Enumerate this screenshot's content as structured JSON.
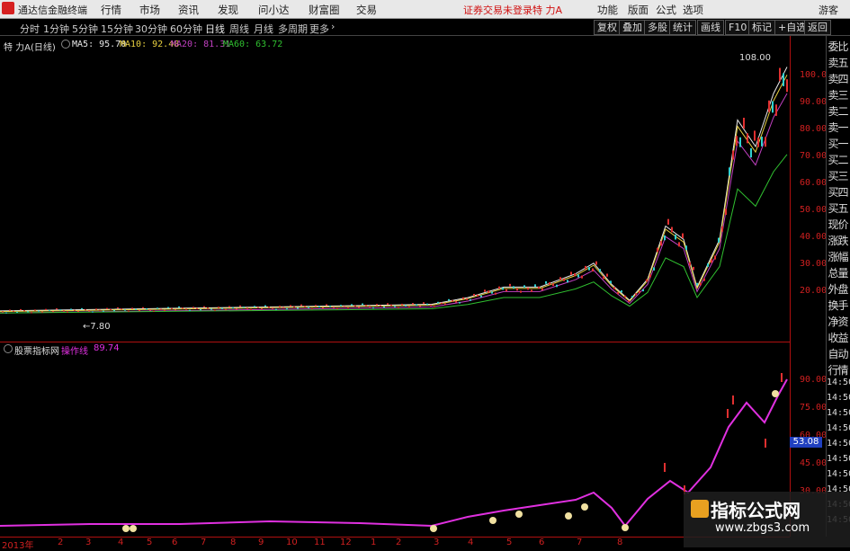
{
  "app": {
    "title": "通达信金融终端",
    "login_status": "证券交易未登录",
    "stock": "特 力A",
    "guest": "游客"
  },
  "menu": [
    "行情",
    "市场",
    "资讯",
    "发现",
    "问小达",
    "财富圈",
    "交易"
  ],
  "right_menu": [
    "功能",
    "版面",
    "公式",
    "选项"
  ],
  "periods": [
    "分时",
    "1分钟",
    "5分钟",
    "15分钟",
    "30分钟",
    "60分钟",
    "日线",
    "周线",
    "月线",
    "多周期",
    "更多"
  ],
  "active_period": "日线",
  "toolbar_buttons": [
    "复权",
    "叠加",
    "多股",
    "统计",
    "画线",
    "F10",
    "标记",
    "+自选",
    "返回"
  ],
  "main_chart": {
    "stock_label": "特 力A(日线)",
    "ma": [
      {
        "name": "MA5",
        "value": "95.70",
        "color": "#e8e8e8"
      },
      {
        "name": "MA10",
        "value": "92.48",
        "color": "#e8d040"
      },
      {
        "name": "MA20",
        "value": "81.31",
        "color": "#c040c0"
      },
      {
        "name": "MA60",
        "value": "63.72",
        "color": "#30c030"
      }
    ],
    "high_label": "108.00",
    "low_label": "7.80",
    "y_ticks": [
      "100.0",
      "90.00",
      "80.00",
      "70.00",
      "60.00",
      "50.00",
      "40.00",
      "30.00",
      "20.00"
    ]
  },
  "indicator": {
    "name": "股票指标网",
    "line_name": "操作线",
    "value": "89.74",
    "current": "53.08",
    "y_ticks": [
      "90.00",
      "75.00",
      "60.00",
      "45.00",
      "30.00"
    ]
  },
  "side_panel": [
    "委比",
    "卖五",
    "卖四",
    "卖三",
    "卖二",
    "卖一",
    "买一",
    "买二",
    "买三",
    "买四",
    "买五",
    "现价",
    "涨跌",
    "涨幅",
    "总量",
    "外盘",
    "换手",
    "净资",
    "收益",
    "自动",
    "行情"
  ],
  "side_times": [
    "14:50",
    "14:50",
    "14:50",
    "14:50",
    "14:50",
    "14:50",
    "14:50",
    "14:50",
    "14:50",
    "14:50"
  ],
  "dates": [
    "2013年",
    "2",
    "3",
    "4",
    "5",
    "6",
    "7",
    "8",
    "9",
    "10",
    "11",
    "12",
    "1",
    "2",
    "3",
    "4",
    "5",
    "6",
    "7",
    "8"
  ],
  "watermark": {
    "title": "指标公式网",
    "url": "www.zbgs3.com"
  },
  "colors": {
    "axis": "#d02020",
    "ma5": "#e8e8e8",
    "ma10": "#e8d040",
    "ma20": "#c040c0",
    "ma60": "#30c030",
    "indicator": "#e030e0"
  }
}
